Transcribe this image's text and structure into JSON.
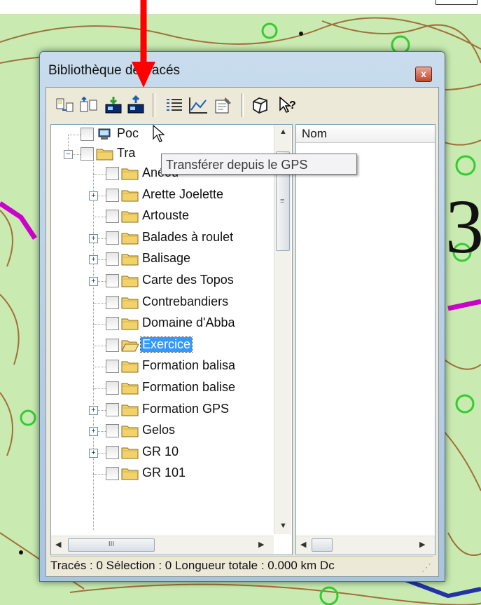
{
  "window": {
    "title": "Bibliothèque de tracés",
    "close_glyph": "x"
  },
  "toolbar": {
    "icons": [
      "import-tracks-icon",
      "export-tracks-icon",
      "transfer-from-gps-icon",
      "transfer-to-gps-icon",
      "list-view-icon",
      "profile-chart-icon",
      "properties-icon",
      "3d-view-icon",
      "help-icon"
    ]
  },
  "tooltip": {
    "text": "Transférer depuis le GPS"
  },
  "tree": {
    "root_items": [
      {
        "label": "PocketPC",
        "visible": "Poc"
      },
      {
        "label": "Tra",
        "visible": "Tra"
      }
    ],
    "folders": [
      {
        "label": "Anéou",
        "expandable": false
      },
      {
        "label": "Arette Joelette",
        "expandable": true
      },
      {
        "label": "Artouste",
        "expandable": false
      },
      {
        "label": "Balades à roulet",
        "expandable": true
      },
      {
        "label": "Balisage",
        "expandable": true
      },
      {
        "label": "Carte des Topos",
        "expandable": true
      },
      {
        "label": "Contrebandiers",
        "expandable": false
      },
      {
        "label": "Domaine d'Abba",
        "expandable": false
      },
      {
        "label": "Exercice",
        "expandable": false,
        "selected": true
      },
      {
        "label": "Formation balisa",
        "expandable": false
      },
      {
        "label": "Formation balise",
        "expandable": false
      },
      {
        "label": "Formation GPS",
        "expandable": true
      },
      {
        "label": "Gelos",
        "expandable": true
      },
      {
        "label": "GR 10",
        "expandable": true
      },
      {
        "label": "GR 101",
        "expandable": false
      }
    ],
    "hscroll_thumb": "III"
  },
  "list": {
    "column_header": "Nom"
  },
  "status": {
    "text": "Tracés : 0 Sélection : 0 Longueur totale : 0.000 km Dc"
  },
  "colors": {
    "map_bg": "#c9ebb1",
    "contour": "#a0703a",
    "accent_red": "#ff0000",
    "selection": "#3399ff"
  }
}
